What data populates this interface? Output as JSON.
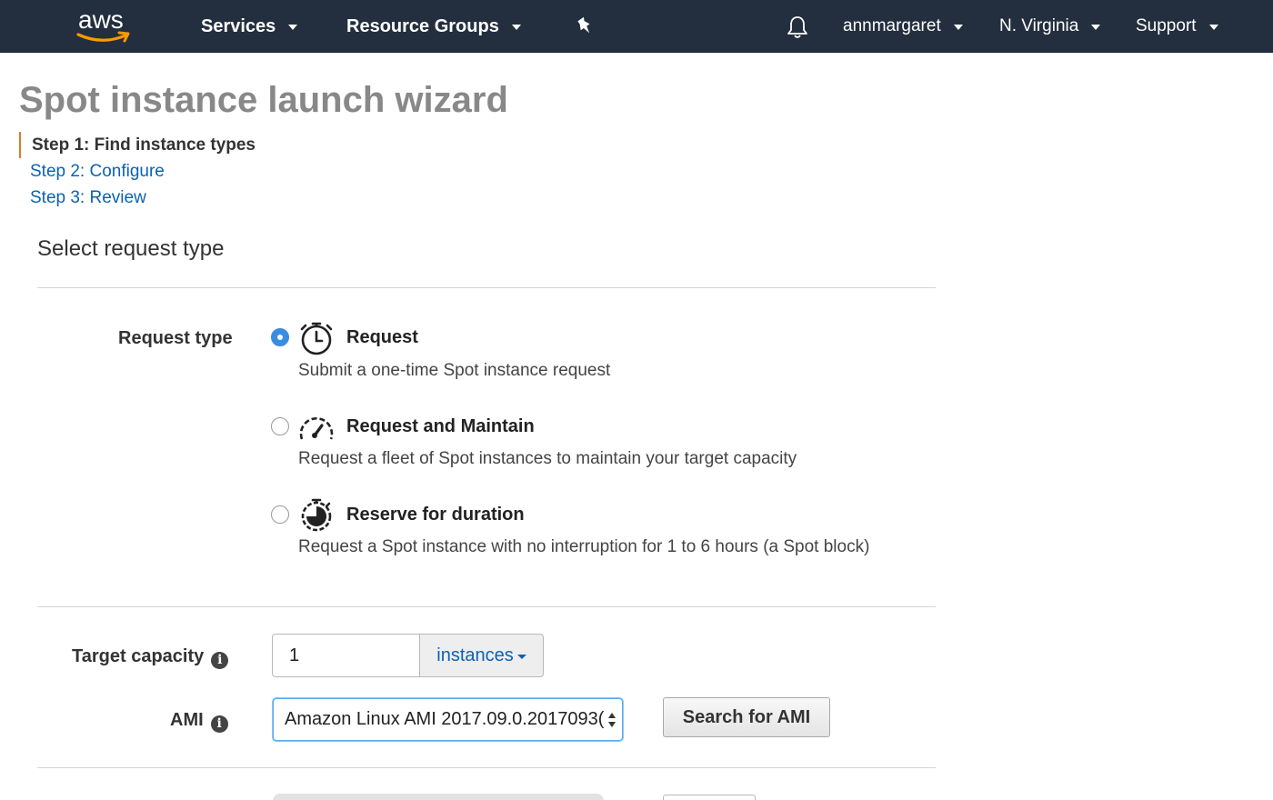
{
  "nav": {
    "logo_text": "aws",
    "services": "Services",
    "resource_groups": "Resource Groups",
    "user": "annmargaret",
    "region": "N. Virginia",
    "support": "Support"
  },
  "page": {
    "title": "Spot instance launch wizard"
  },
  "steps": [
    {
      "label": "Step 1: Find instance types",
      "active": true
    },
    {
      "label": "Step 2: Configure",
      "active": false
    },
    {
      "label": "Step 3: Review",
      "active": false
    }
  ],
  "section": {
    "title": "Select request type"
  },
  "request_type": {
    "label": "Request type",
    "options": [
      {
        "title": "Request",
        "description": "Submit a one-time Spot instance request",
        "selected": true,
        "icon": "stopwatch-icon"
      },
      {
        "title": "Request and Maintain",
        "description": "Request a fleet of Spot instances to maintain your target capacity",
        "selected": false,
        "icon": "speedometer-icon"
      },
      {
        "title": "Reserve for duration",
        "description": "Request a Spot instance with no interruption for 1 to 6 hours (a Spot block)",
        "selected": false,
        "icon": "timer-filled-icon"
      }
    ]
  },
  "target_capacity": {
    "label": "Target capacity",
    "value": "1",
    "unit": "instances"
  },
  "ami": {
    "label": "AMI",
    "value": "Amazon Linux AMI 2017.09.0.2017093(",
    "search_button": "Search for AMI"
  },
  "colors": {
    "nav_bg": "#232f3e",
    "accent_orange": "#ff9900",
    "link_blue": "#0a62b4",
    "radio_blue": "#3a8de0"
  }
}
